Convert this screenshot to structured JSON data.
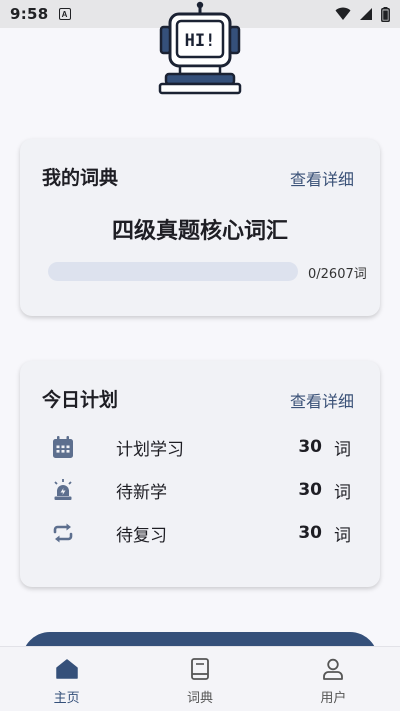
{
  "status_bar": {
    "time": "9:58",
    "notification_letter": "A"
  },
  "robot": {
    "screen_text": "HI!"
  },
  "dictionary_card": {
    "title": "我的词典",
    "detail_link": "查看详细",
    "dictionary_name": "四级真题核心词汇",
    "progress_text": "0/2607词",
    "progress_fraction": 0
  },
  "plan_card": {
    "title": "今日计划",
    "detail_link": "查看详细",
    "rows": [
      {
        "icon": "calendar-icon",
        "label": "计划学习",
        "count": "30",
        "unit": "词"
      },
      {
        "icon": "alarm-light-icon",
        "label": "待新学",
        "count": "30",
        "unit": "词"
      },
      {
        "icon": "repeat-icon",
        "label": "待复习",
        "count": "30",
        "unit": "词"
      }
    ]
  },
  "bottom_nav": {
    "items": [
      {
        "icon": "home-icon",
        "label": "主页",
        "active": true
      },
      {
        "icon": "book-icon",
        "label": "词典",
        "active": false
      },
      {
        "icon": "user-icon",
        "label": "用户",
        "active": false
      }
    ]
  },
  "colors": {
    "accent": "#35507a",
    "link": "#3b5278",
    "card_bg": "#f1f2f6",
    "page_bg": "#f7f7fb"
  }
}
